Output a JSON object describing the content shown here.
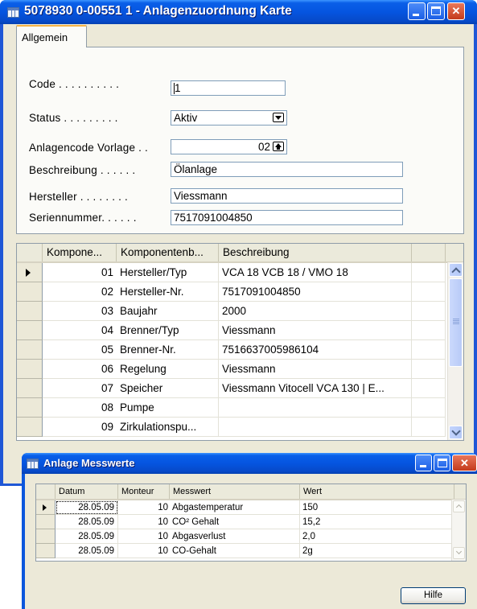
{
  "main_window": {
    "title": "5078930 0-00551 1 - Anlagenzuordnung Karte",
    "tab": "Allgemein",
    "form": {
      "code_label": "Code . . . . . . . . . .",
      "code_value": "1",
      "status_label": "Status . . . . . . . . .",
      "status_value": "Aktiv",
      "vorlage_label": "Anlagencode Vorlage . .",
      "vorlage_value": "02",
      "beschreibung_label": "Beschreibung . . . . . .",
      "beschreibung_value": "Ölanlage",
      "hersteller_label": "Hersteller . . . . . . . .",
      "hersteller_value": "Viessmann",
      "seriennummer_label": "Seriennummer. . . . . .",
      "seriennummer_value": "7517091004850"
    },
    "grid": {
      "headers": [
        "Kompone...",
        "Komponentenb...",
        "Beschreibung"
      ],
      "rows": [
        {
          "nr": "01",
          "komp": "Hersteller/Typ",
          "beschr": "VCA 18 VCB 18 / VMO 18"
        },
        {
          "nr": "02",
          "komp": "Hersteller-Nr.",
          "beschr": "7517091004850"
        },
        {
          "nr": "03",
          "komp": "Baujahr",
          "beschr": "2000"
        },
        {
          "nr": "04",
          "komp": "Brenner/Typ",
          "beschr": "Viessmann"
        },
        {
          "nr": "05",
          "komp": "Brenner-Nr.",
          "beschr": "7516637005986104"
        },
        {
          "nr": "06",
          "komp": "Regelung",
          "beschr": "Viessmann"
        },
        {
          "nr": "07",
          "komp": "Speicher",
          "beschr": "Viessmann Vitocell VCA 130 | E..."
        },
        {
          "nr": "08",
          "komp": "Pumpe",
          "beschr": ""
        },
        {
          "nr": "09",
          "komp": "Zirkulationspu...",
          "beschr": ""
        }
      ]
    }
  },
  "sub_window": {
    "title": "Anlage Messwerte",
    "headers": [
      "Datum",
      "Monteur",
      "Messwert",
      "Wert"
    ],
    "rows": [
      {
        "datum": "28.05.09",
        "monteur": "10",
        "messwert": "Abgastemperatur",
        "wert": "150"
      },
      {
        "datum": "28.05.09",
        "monteur": "10",
        "messwert": "CO² Gehalt",
        "wert": "15,2"
      },
      {
        "datum": "28.05.09",
        "monteur": "10",
        "messwert": "Abgasverlust",
        "wert": "2,0"
      },
      {
        "datum": "28.05.09",
        "monteur": "10",
        "messwert": "CO-Gehalt",
        "wert": "2g"
      }
    ],
    "help_label": "Hilfe"
  },
  "colors": {
    "titlebar": "#0555e0",
    "client": "#ece9d8",
    "close_button": "#c43b1c"
  }
}
